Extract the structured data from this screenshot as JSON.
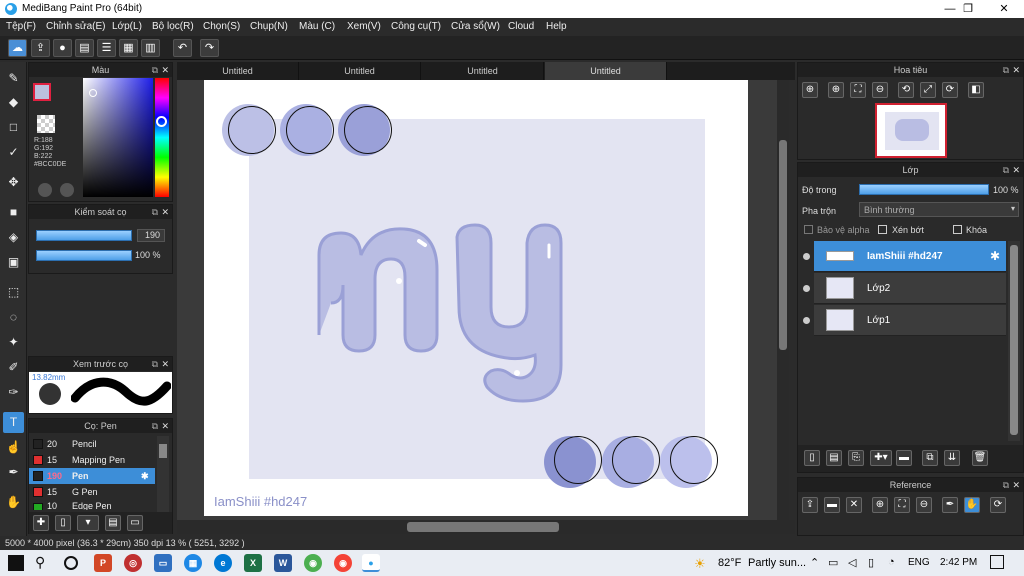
{
  "app": {
    "title": "MediBang Paint Pro (64bit)"
  },
  "window_controls": {
    "minimize": "—",
    "maximize": "❐",
    "close": "✕"
  },
  "menu": [
    "Tệp(F)",
    "Chỉnh sửa(E)",
    "Lớp(L)",
    "Bộ lọc(R)",
    "Chọn(S)",
    "Chụp(N)",
    "Màu (C)",
    "Xem(V)",
    "Công cụ(T)",
    "Cửa sổ(W)",
    "Cloud",
    "Help"
  ],
  "tabs": [
    "Untitled",
    "Untitled",
    "Untitled",
    "Untitled"
  ],
  "color_panel": {
    "title": "Màu",
    "rgb": [
      "R:188",
      "G:192",
      "B:222"
    ],
    "hex": "#BCC0DE",
    "color": "#BCC0DE"
  },
  "brush_control": {
    "title": "Kiểm soát cọ",
    "size": "190",
    "opacity": "100 %"
  },
  "brush_preview": {
    "title": "Xem trước cọ",
    "size_label": "13.82mm"
  },
  "brush_list": {
    "title": "Cọ: Pen",
    "items": [
      {
        "size": "20",
        "name": "Pencil",
        "color": "#222222"
      },
      {
        "size": "15",
        "name": "Mapping Pen",
        "color": "#e03030"
      },
      {
        "size": "190",
        "name": "Pen",
        "color": "#222222"
      },
      {
        "size": "15",
        "name": "G Pen",
        "color": "#e03030"
      },
      {
        "size": "10",
        "name": "Edge Pen",
        "color": "#22aa22"
      }
    ]
  },
  "navigator": {
    "title": "Hoa tiêu"
  },
  "layers_panel": {
    "title": "Lớp",
    "opacity_label": "Độ trong",
    "opacity_value": "100 %",
    "blend_label": "Pha trộn",
    "blend_value": "Bình thường",
    "protect_alpha": "Bảo vệ alpha",
    "clipping": "Xén bớt",
    "lock": "Khóa",
    "layers": [
      {
        "name": "IamShiii #hd247",
        "selected": true
      },
      {
        "name": "Lớp2",
        "selected": false
      },
      {
        "name": "Lớp1",
        "selected": false
      }
    ]
  },
  "reference_panel": {
    "title": "Reference"
  },
  "canvas": {
    "text": "IamShiii #hd247",
    "bg_color": "#e3e4f2",
    "letter_color": "#b9bde3"
  },
  "swatches": [
    {
      "color": "#bcc0e6"
    },
    {
      "color": "#aab0e2"
    },
    {
      "color": "#9aa0d8"
    },
    {
      "color": "#8a92d0"
    },
    {
      "color": "#a8aee2"
    },
    {
      "color": "#bcc0ec"
    }
  ],
  "status": {
    "info": "5000 * 4000 pixel  (36.3 * 29cm)  350 dpi  13 %  ( 5251, 3292 )"
  },
  "taskbar": {
    "weather_temp": "82°F",
    "weather_text": "Partly sun...",
    "lang": "ENG",
    "time": "2:42 PM"
  }
}
